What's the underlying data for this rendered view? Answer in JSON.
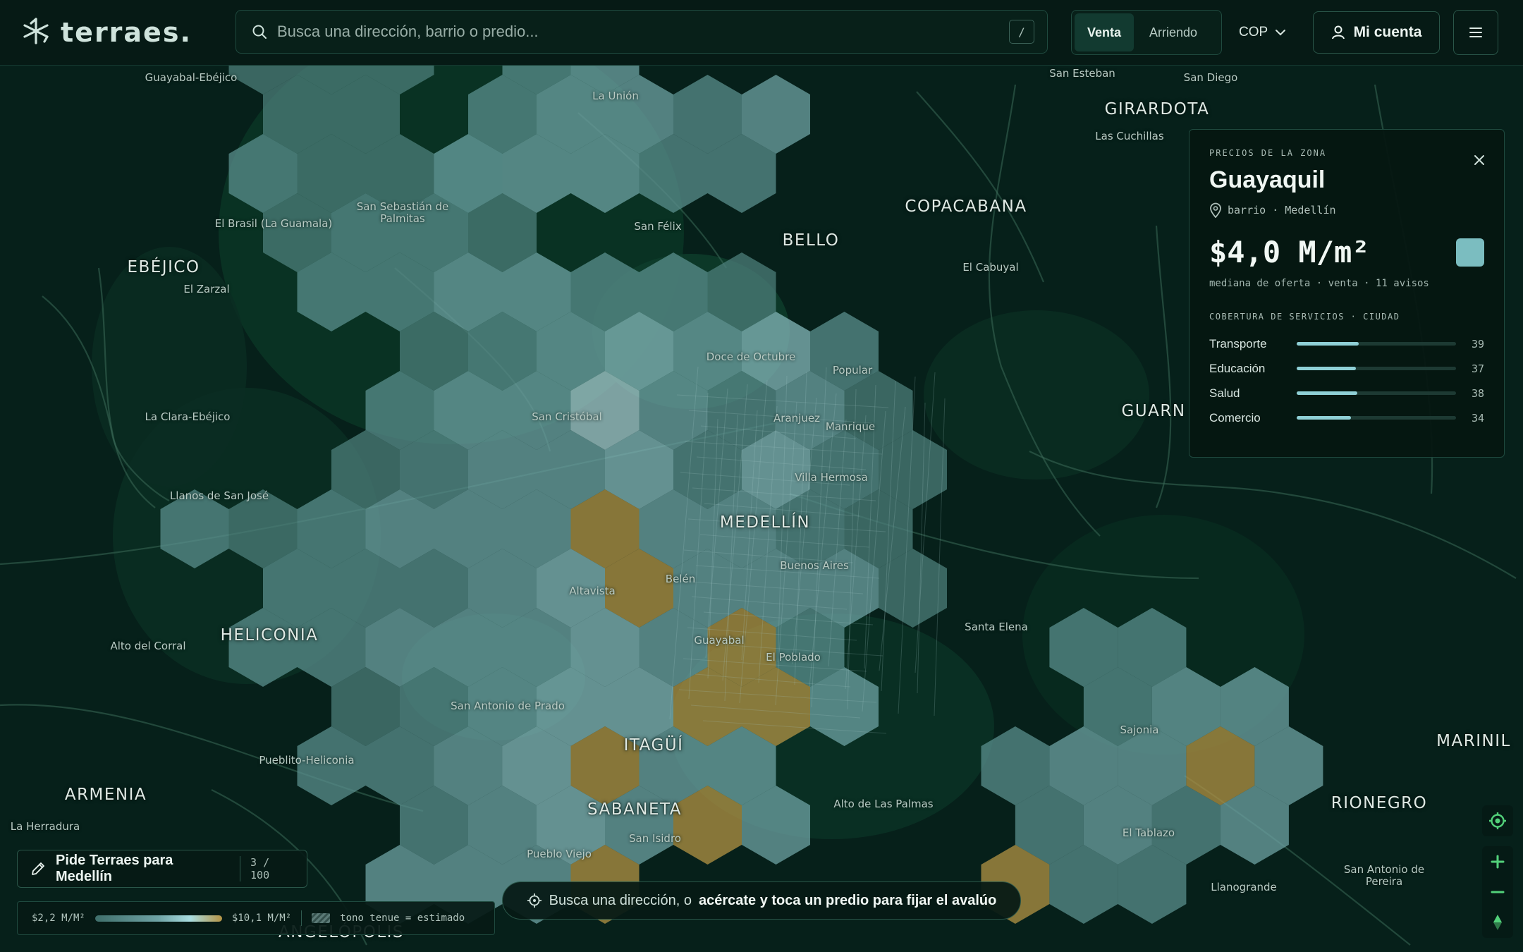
{
  "brand": {
    "name": "terraes."
  },
  "search": {
    "placeholder": "Busca una dirección, barrio o predio...",
    "shortcut": "/"
  },
  "mode": {
    "sale": "Venta",
    "rent": "Arriendo",
    "active": "sale"
  },
  "currency": {
    "value": "COP"
  },
  "account": {
    "label": "Mi cuenta"
  },
  "icons": {
    "logo": "star-logo-icon",
    "search": "search-icon",
    "chevron": "chevron-down-icon",
    "user": "user-icon",
    "menu": "menu-icon",
    "close": "close-icon",
    "pin": "map-pin-icon",
    "edit": "pencil-icon",
    "target": "crosshair-icon",
    "locate": "locate-icon",
    "zoom_in": "plus-icon",
    "zoom_out": "minus-icon",
    "compass": "compass-icon"
  },
  "zone": {
    "kicker": "PRECIOS DE LA ZONA",
    "name": "Guayaquil",
    "type_city": "barrio · Medellín",
    "price": "$4,0 M/m²",
    "median_note": "mediana de oferta · venta · 11 avisos",
    "coverage_title": "COBERTURA DE SERVICIOS · CIUDAD",
    "coverage": [
      {
        "label": "Transporte",
        "value": 39
      },
      {
        "label": "Educación",
        "value": 37
      },
      {
        "label": "Salud",
        "value": 38
      },
      {
        "label": "Comercio",
        "value": 34
      }
    ],
    "coverage_max": 100
  },
  "ask": {
    "label": "Pide Terraes para Medellín",
    "count": "3 / 100"
  },
  "legend": {
    "min": "$2,2 M/M²",
    "max": "$10,1 M/M²",
    "estimated_note": "tono tenue = estimado"
  },
  "hint": {
    "text": "Busca una dirección, o",
    "strong": "acércate y toca un predio para fijar el avalúo"
  },
  "colors": {
    "background": "#06201a",
    "accent": "#8fd0d6",
    "hex_low": "#3f6f6b",
    "hex_mid": "#6fa3a5",
    "hex_high": "#b59445",
    "selected_swatch": "#7bbdc0"
  },
  "map": {
    "cities": [
      "MEDELLÍN",
      "BELLO",
      "COPACABANA",
      "GIRARDOTA",
      "ITAGÜÍ",
      "SABANETA",
      "EBÉJICO",
      "HELICONIA",
      "ARMENIA",
      "RIONEGRO",
      "MARINIL",
      "GUARN",
      "ANGELÓPOLIS"
    ],
    "places": [
      "Guayabal-Ebéjico",
      "La Unión",
      "San Esteban",
      "San Diego",
      "Las Cuchillas",
      "San Sebastián de Palmitas",
      "El Brasil (La Guamala)",
      "San Félix",
      "El Zarzal",
      "El Cabuyal",
      "Doce de Octubre",
      "Popular",
      "San Cristóbal",
      "Aranjuez",
      "Manrique",
      "La Clara-Ebéjico",
      "Villa Hermosa",
      "Llanos de San José",
      "Buenos Aires",
      "Altavista",
      "Belén",
      "Santa Elena",
      "Guayabal",
      "El Poblado",
      "Alto del Corral",
      "San Antonio de Prado",
      "Sajonia",
      "Pueblito-Heliconia",
      "Alto de Las Palmas",
      "El Tablazo",
      "La Herradura",
      "San Isidro",
      "Pueblo Viejo",
      "Llanogrande",
      "San Antonio de Pereira"
    ]
  }
}
